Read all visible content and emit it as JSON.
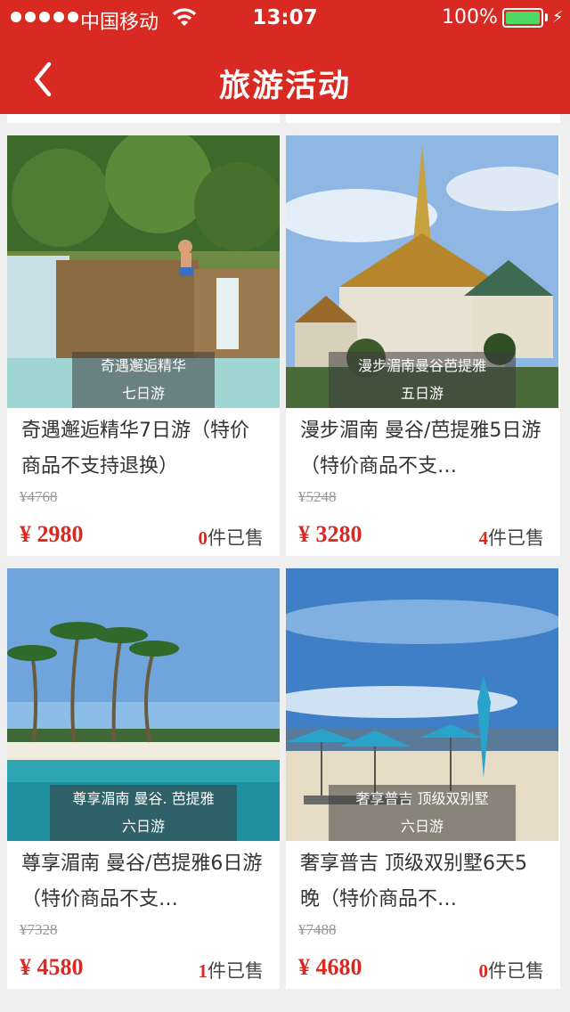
{
  "status_bar": {
    "carrier": "中国移动",
    "time": "13:07",
    "battery": "100%"
  },
  "nav": {
    "title": "旅游活动"
  },
  "products": [
    {
      "caption_line1": "奇遇邂逅精华",
      "caption_line2": "七日游",
      "title": "奇遇邂逅精华7日游（特价商品不支持退换）",
      "original_price": "¥4768",
      "price": "¥ 2980",
      "sold_count": "0",
      "sold_suffix": "件已售"
    },
    {
      "caption_line1": "漫步湄南曼谷芭提雅",
      "caption_line2": "五日游",
      "title": "漫步湄南 曼谷/芭提雅5日游（特价商品不支…",
      "original_price": "¥5248",
      "price": "¥ 3280",
      "sold_count": "4",
      "sold_suffix": "件已售"
    },
    {
      "caption_line1": "尊享湄南  曼谷. 芭提雅",
      "caption_line2": "六日游",
      "title": "尊享湄南 曼谷/芭提雅6日游（特价商品不支…",
      "original_price": "¥7328",
      "price": "¥ 4580",
      "sold_count": "1",
      "sold_suffix": "件已售"
    },
    {
      "caption_line1": "奢享普吉  顶级双别墅",
      "caption_line2": "六日游",
      "title": "奢享普吉 顶级双别墅6天5晚（特价商品不…",
      "original_price": "¥7488",
      "price": "¥ 4680",
      "sold_count": "0",
      "sold_suffix": "件已售"
    }
  ],
  "colors": {
    "header": "#d82a22",
    "price": "#d82a22",
    "battery": "#4cd964"
  }
}
